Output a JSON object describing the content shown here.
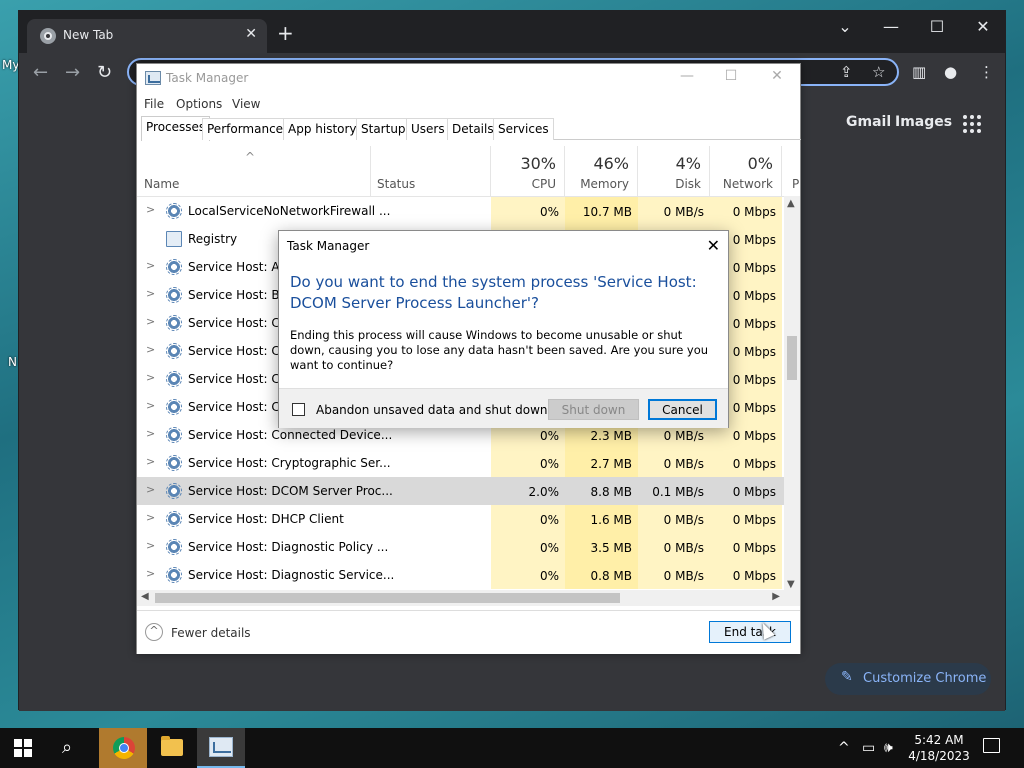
{
  "desktop": {
    "icon_text_1": "My",
    "icon_text_2": "N"
  },
  "browser": {
    "tab_title": "New Tab",
    "tab_close": "✕",
    "new_tab": "+",
    "header_links": {
      "gmail": "Gmail",
      "images": "Images"
    },
    "customize_label": "Customize Chrome"
  },
  "task_manager": {
    "title": "Task Manager",
    "menu": [
      "File",
      "Options",
      "View"
    ],
    "tabs": [
      "Processes",
      "Performance",
      "App history",
      "Startup",
      "Users",
      "Details",
      "Services"
    ],
    "columns": {
      "name": "Name",
      "status": "Status",
      "cpu": {
        "percent": "30%",
        "label": "CPU"
      },
      "memory": {
        "percent": "46%",
        "label": "Memory"
      },
      "disk": {
        "percent": "4%",
        "label": "Disk"
      },
      "network": {
        "percent": "0%",
        "label": "Network"
      },
      "power_truncated": "P"
    },
    "rows": [
      {
        "name": "LocalServiceNoNetworkFirewall ...",
        "cpu": "0%",
        "memory": "10.7 MB",
        "disk": "0 MB/s",
        "network": "0 Mbps"
      },
      {
        "name": "Registry",
        "cpu": "",
        "memory": "",
        "disk": "",
        "network": "0 Mbps"
      },
      {
        "name": "Service Host: App",
        "cpu": "",
        "memory": "",
        "disk": "",
        "network": "0 Mbps"
      },
      {
        "name": "Service Host: Bac",
        "cpu": "",
        "memory": "",
        "disk": "",
        "network": "0 Mbps"
      },
      {
        "name": "Service Host: Cap",
        "cpu": "",
        "memory": "",
        "disk": "",
        "network": "0 Mbps"
      },
      {
        "name": "Service Host: Clip",
        "cpu": "",
        "memory": "",
        "disk": "",
        "network": "0 Mbps"
      },
      {
        "name": "Service Host: CON",
        "cpu": "",
        "memory": "",
        "disk": "",
        "network": "0 Mbps"
      },
      {
        "name": "Service Host: Con",
        "cpu": "",
        "memory": "",
        "disk": "",
        "network": "0 Mbps"
      },
      {
        "name": "Service Host: Connected Device...",
        "cpu": "0%",
        "memory": "2.3 MB",
        "disk": "0 MB/s",
        "network": "0 Mbps"
      },
      {
        "name": "Service Host: Cryptographic Ser...",
        "cpu": "0%",
        "memory": "2.7 MB",
        "disk": "0 MB/s",
        "network": "0 Mbps"
      },
      {
        "name": "Service Host: DCOM Server Proc...",
        "cpu": "2.0%",
        "memory": "8.8 MB",
        "disk": "0.1 MB/s",
        "network": "0 Mbps"
      },
      {
        "name": "Service Host: DHCP Client",
        "cpu": "0%",
        "memory": "1.6 MB",
        "disk": "0 MB/s",
        "network": "0 Mbps"
      },
      {
        "name": "Service Host: Diagnostic Policy ...",
        "cpu": "0%",
        "memory": "3.5 MB",
        "disk": "0 MB/s",
        "network": "0 Mbps"
      },
      {
        "name": "Service Host: Diagnostic Service...",
        "cpu": "0%",
        "memory": "0.8 MB",
        "disk": "0 MB/s",
        "network": "0 Mbps"
      }
    ],
    "fewer_details": "Fewer details",
    "end_task": "End task"
  },
  "dialog": {
    "title": "Task Manager",
    "close": "✕",
    "heading": "Do you want to end the system process 'Service Host: DCOM Server Process Launcher'?",
    "body": "Ending this process will cause Windows to become unusable or shut down, causing you to lose any data hasn't been saved. Are you sure you want to continue?",
    "checkbox_label": "Abandon unsaved data and shut down.",
    "shutdown_label": "Shut down",
    "cancel_label": "Cancel"
  },
  "taskbar": {
    "time": "5:42 AM",
    "date": "4/18/2023"
  }
}
